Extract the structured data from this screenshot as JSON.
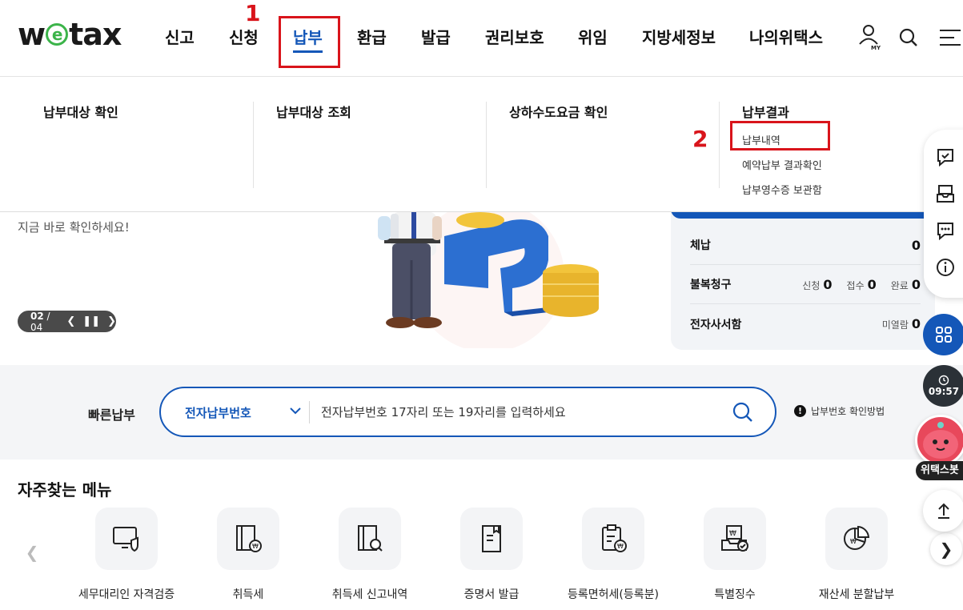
{
  "header": {
    "logo_prefix": "w",
    "logo_e": "e",
    "logo_suffix": "tax",
    "nav": [
      "신고",
      "신청",
      "납부",
      "환급",
      "발급",
      "권리보호",
      "위임",
      "지방세정보",
      "나의위택스"
    ],
    "active_nav": "납부",
    "my_label": "MY"
  },
  "annotations": {
    "step1": "1",
    "step2": "2"
  },
  "mega_menu": {
    "columns": [
      {
        "title": "납부대상 확인",
        "items": []
      },
      {
        "title": "납부대상 조회",
        "items": []
      },
      {
        "title": "상하수도요금 확인",
        "items": []
      },
      {
        "title": "납부결과",
        "items": [
          "납부내역",
          "예약납부 결과확인",
          "납부영수증 보관함"
        ]
      }
    ]
  },
  "hero": {
    "subtitle": "지금 바로 확인하세요!",
    "slider_current": "02",
    "slider_total": "04"
  },
  "summary": {
    "rows": [
      {
        "label": "체납",
        "values": [
          {
            "name": "",
            "count": "0"
          }
        ]
      },
      {
        "label": "불복청구",
        "values": [
          {
            "name": "신청",
            "count": "0"
          },
          {
            "name": "접수",
            "count": "0"
          },
          {
            "name": "완료",
            "count": "0"
          }
        ]
      },
      {
        "label": "전자사서함",
        "values": [
          {
            "name": "미열람",
            "count": "0"
          }
        ]
      }
    ]
  },
  "quick_pay": {
    "label": "빠른납부",
    "select_value": "전자납부번호",
    "placeholder": "전자납부번호 17자리 또는 19자리를 입력하세요",
    "help": "납부번호 확인방법",
    "help_mark": "!"
  },
  "frequent": {
    "title": "자주찾는 메뉴",
    "items": [
      "세무대리인 자격검증",
      "취득세",
      "취득세 신고내역",
      "증명서 발급",
      "등록면허세(등록분)",
      "특별징수",
      "재산세 분할납부"
    ]
  },
  "floating": {
    "time": "09:57",
    "bot_label": "위택스봇"
  },
  "colors": {
    "brand_blue": "#1457b8",
    "logo_green": "#3cb44a",
    "annotation_red": "#d9141b"
  }
}
